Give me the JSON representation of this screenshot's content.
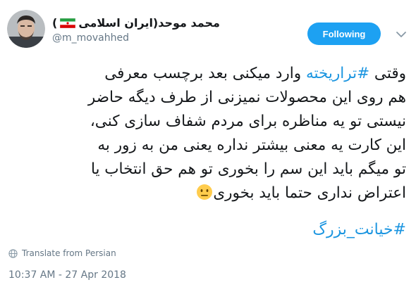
{
  "user": {
    "display_name": "محمد موحد(ایران اسلامی",
    "paren_close": ")",
    "handle": "@m_movahhed",
    "flag_icon": "iran-flag-icon",
    "avatar_icon": "avatar"
  },
  "follow_button": {
    "label": "Following"
  },
  "tweet": {
    "line1_prefix": "وقتی ",
    "line1_hashtag": "#تراریخته",
    "line1_suffix": " وارد میکنی بعد برچسب معرفی",
    "line2": "هم روی این محصولات نمیزنی از طرف دیگه حاضر",
    "line3": "نیستی تو یه مناظره برای مردم شفاف سازی کنی،",
    "line4": "این کارت یه معنی بیشتر نداره یعنی من به زور به",
    "line5": "تو میگم باید این سم را بخوری تو هم حق انتخاب یا",
    "line6": "اعتراض نداری حتما باید بخوری",
    "emoji_icon": "neutral-face-emoji",
    "hashtag_line": "#خیانت_بزرگ"
  },
  "translate": {
    "label": "Translate from Persian",
    "icon": "globe-icon"
  },
  "timestamp": "10:37 AM - 27 Apr 2018",
  "colors": {
    "accent": "#1da1f2",
    "link": "#1b95e0",
    "text": "#14171a",
    "muted": "#657786"
  }
}
